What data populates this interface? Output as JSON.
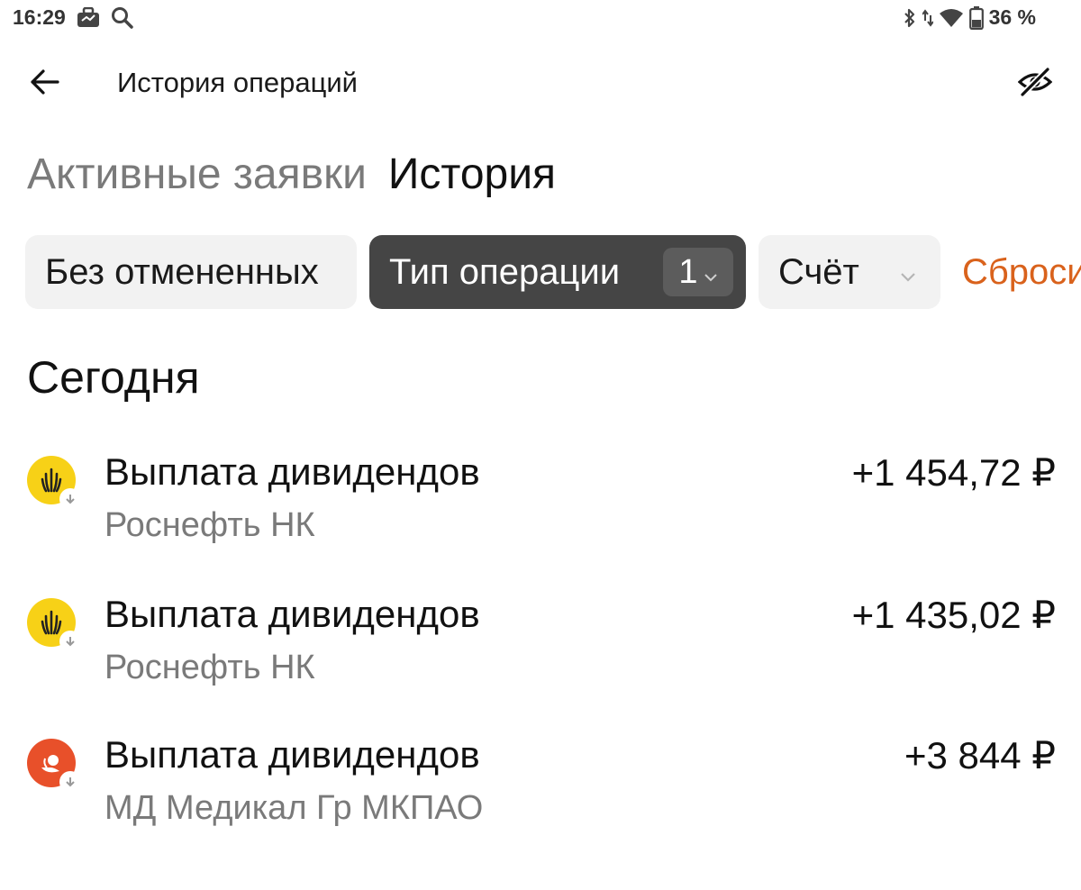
{
  "status_bar": {
    "time": "16:29",
    "battery": "36 %",
    "icons": [
      "briefcase-icon",
      "search-icon",
      "bluetooth-icon",
      "signal-arrows-icon",
      "wifi-icon",
      "battery-icon"
    ]
  },
  "header": {
    "title": "История операций",
    "back_icon": "arrow-left-icon",
    "visibility_icon": "eye-off-icon"
  },
  "tabs": [
    {
      "label": "Активные заявки",
      "active": false
    },
    {
      "label": "История",
      "active": true
    }
  ],
  "filters": {
    "without_cancelled": "Без отмененных",
    "operation_type": "Тип операции",
    "operation_type_count": "1",
    "account": "Счёт",
    "reset": "Сброси"
  },
  "section": {
    "title": "Сегодня"
  },
  "operations": [
    {
      "title": "Выплата дивидендов",
      "subtitle": "Роснефть НК",
      "amount": "+1 454,72 ₽",
      "logo": "rosneft-logo-icon",
      "logo_color": "#f7d117"
    },
    {
      "title": "Выплата дивидендов",
      "subtitle": "Роснефть НК",
      "amount": "+1 435,02 ₽",
      "logo": "rosneft-logo-icon",
      "logo_color": "#f7d117"
    },
    {
      "title": "Выплата дивидендов",
      "subtitle": "МД Медикал Гр МКПАО",
      "amount": "+3 844 ₽",
      "logo": "md-medical-logo-icon",
      "logo_color": "#e8502a"
    }
  ],
  "colors": {
    "accent_reset": "#d9621c",
    "chip_bg": "#f2f2f2",
    "chip_active_bg": "#454545",
    "muted_text": "#7a7a7a"
  }
}
